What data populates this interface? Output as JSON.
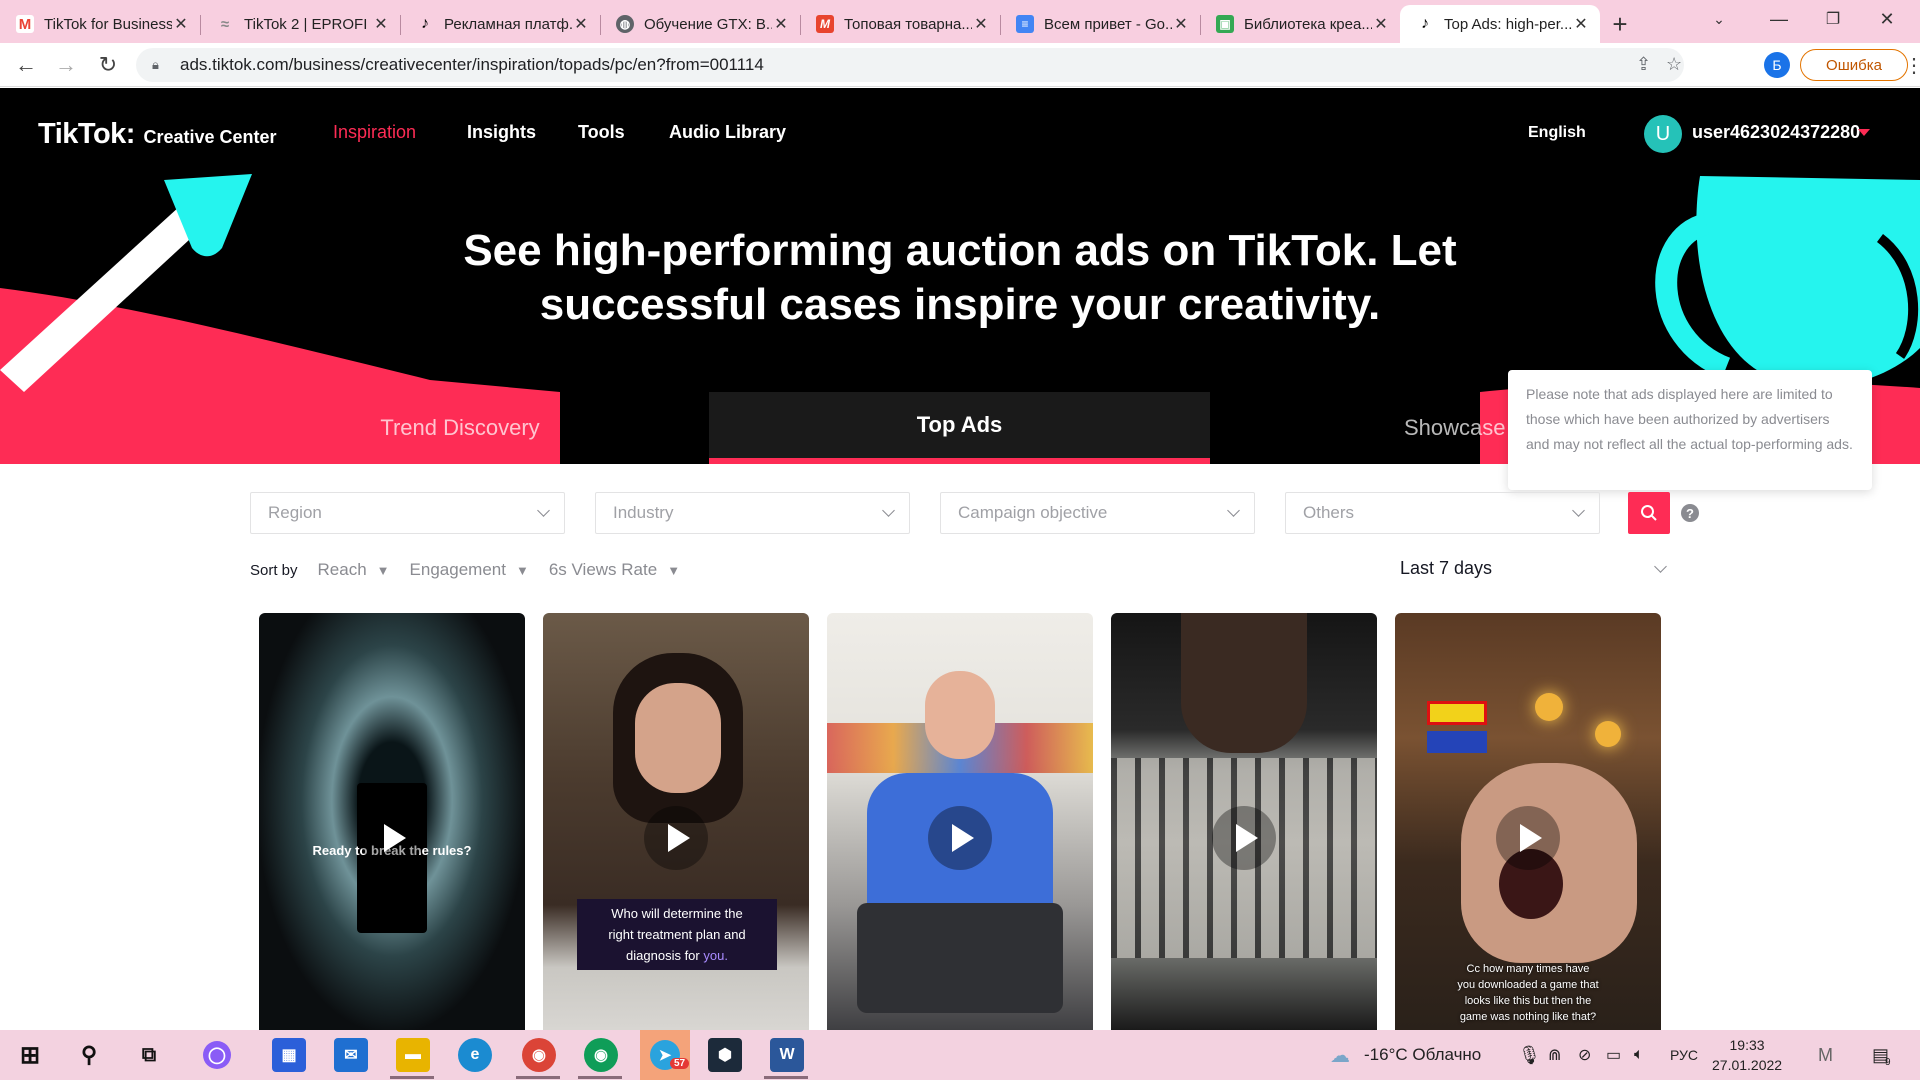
{
  "browser": {
    "tabs": [
      {
        "title": "TikTok for Business",
        "favicon": "gmail-icon",
        "color": "#ea4335",
        "glyph": "M"
      },
      {
        "title": "TikTok 2 | EPROFI",
        "favicon": "eprofi-icon",
        "color": "#8a8a8a",
        "glyph": "≈"
      },
      {
        "title": "Рекламная платф...",
        "favicon": "tiktok-icon",
        "color": "#000000",
        "glyph": "♪"
      },
      {
        "title": "Обучение GTX: B...",
        "favicon": "globe-icon",
        "color": "#5f6368",
        "glyph": "◍"
      },
      {
        "title": "Топовая товарна...",
        "favicon": "mi-icon",
        "color": "#e8442e",
        "glyph": "M"
      },
      {
        "title": "Всем привет - Go...",
        "favicon": "docs-icon",
        "color": "#4285f4",
        "glyph": "≡"
      },
      {
        "title": "Библиотека креа...",
        "favicon": "library-icon",
        "color": "#34a853",
        "glyph": "▣"
      },
      {
        "title": "Top Ads: high-per...",
        "favicon": "tiktok-icon",
        "color": "#000000",
        "glyph": "♪",
        "active": true
      }
    ],
    "url": "ads.tiktok.com/business/creativecenter/inspiration/topads/pc/en?from=001114",
    "profile_initial": "Б",
    "error_label": "Ошибка"
  },
  "site": {
    "logo_main": "TikTok",
    "logo_dot": ":",
    "logo_sub": "Creative Center",
    "nav": [
      "Inspiration",
      "Insights",
      "Tools",
      "Audio Library"
    ],
    "language": "English",
    "avatar_initial": "U",
    "username": "user4623024372280",
    "headline_line1": "See high-performing auction ads on TikTok. Let",
    "headline_line2": "successful cases inspire your creativity.",
    "tabs": [
      "Trend Discovery",
      "Top Ads",
      "Showcase"
    ],
    "tooltip": "Please note that ads displayed here are limited to those which have been authorized by advertisers and may not reflect all the actual top-performing ads."
  },
  "filters": {
    "region": "Region",
    "industry": "Industry",
    "objective": "Campaign objective",
    "others": "Others",
    "help": "?"
  },
  "sort": {
    "label": "Sort by",
    "options": [
      "Reach",
      "Engagement",
      "6s Views Rate"
    ],
    "period": "Last 7 days"
  },
  "cards": [
    {
      "caption": "Ready to break the rules?"
    },
    {
      "caption_line1": "Who will determine the",
      "caption_line2": "right treatment plan and",
      "caption_line3": "diagnosis for",
      "caption_highlight": "you."
    },
    {
      "caption": ""
    },
    {
      "caption": ""
    },
    {
      "caption_line1": "Cc how many times have",
      "caption_line2": "you downloaded a game that",
      "caption_line3": "looks like this but then the",
      "caption_line4": "game was nothing like that?"
    }
  ],
  "taskbar": {
    "weather": "-16°C Облачно",
    "lang": "РУС",
    "time": "19:33",
    "date": "27.01.2022",
    "telegram_badge": "57",
    "notif_badge": "9"
  },
  "colors": {
    "accent": "#fe2c55",
    "cyan": "#25f4ee",
    "hero_bg": "#000000"
  }
}
